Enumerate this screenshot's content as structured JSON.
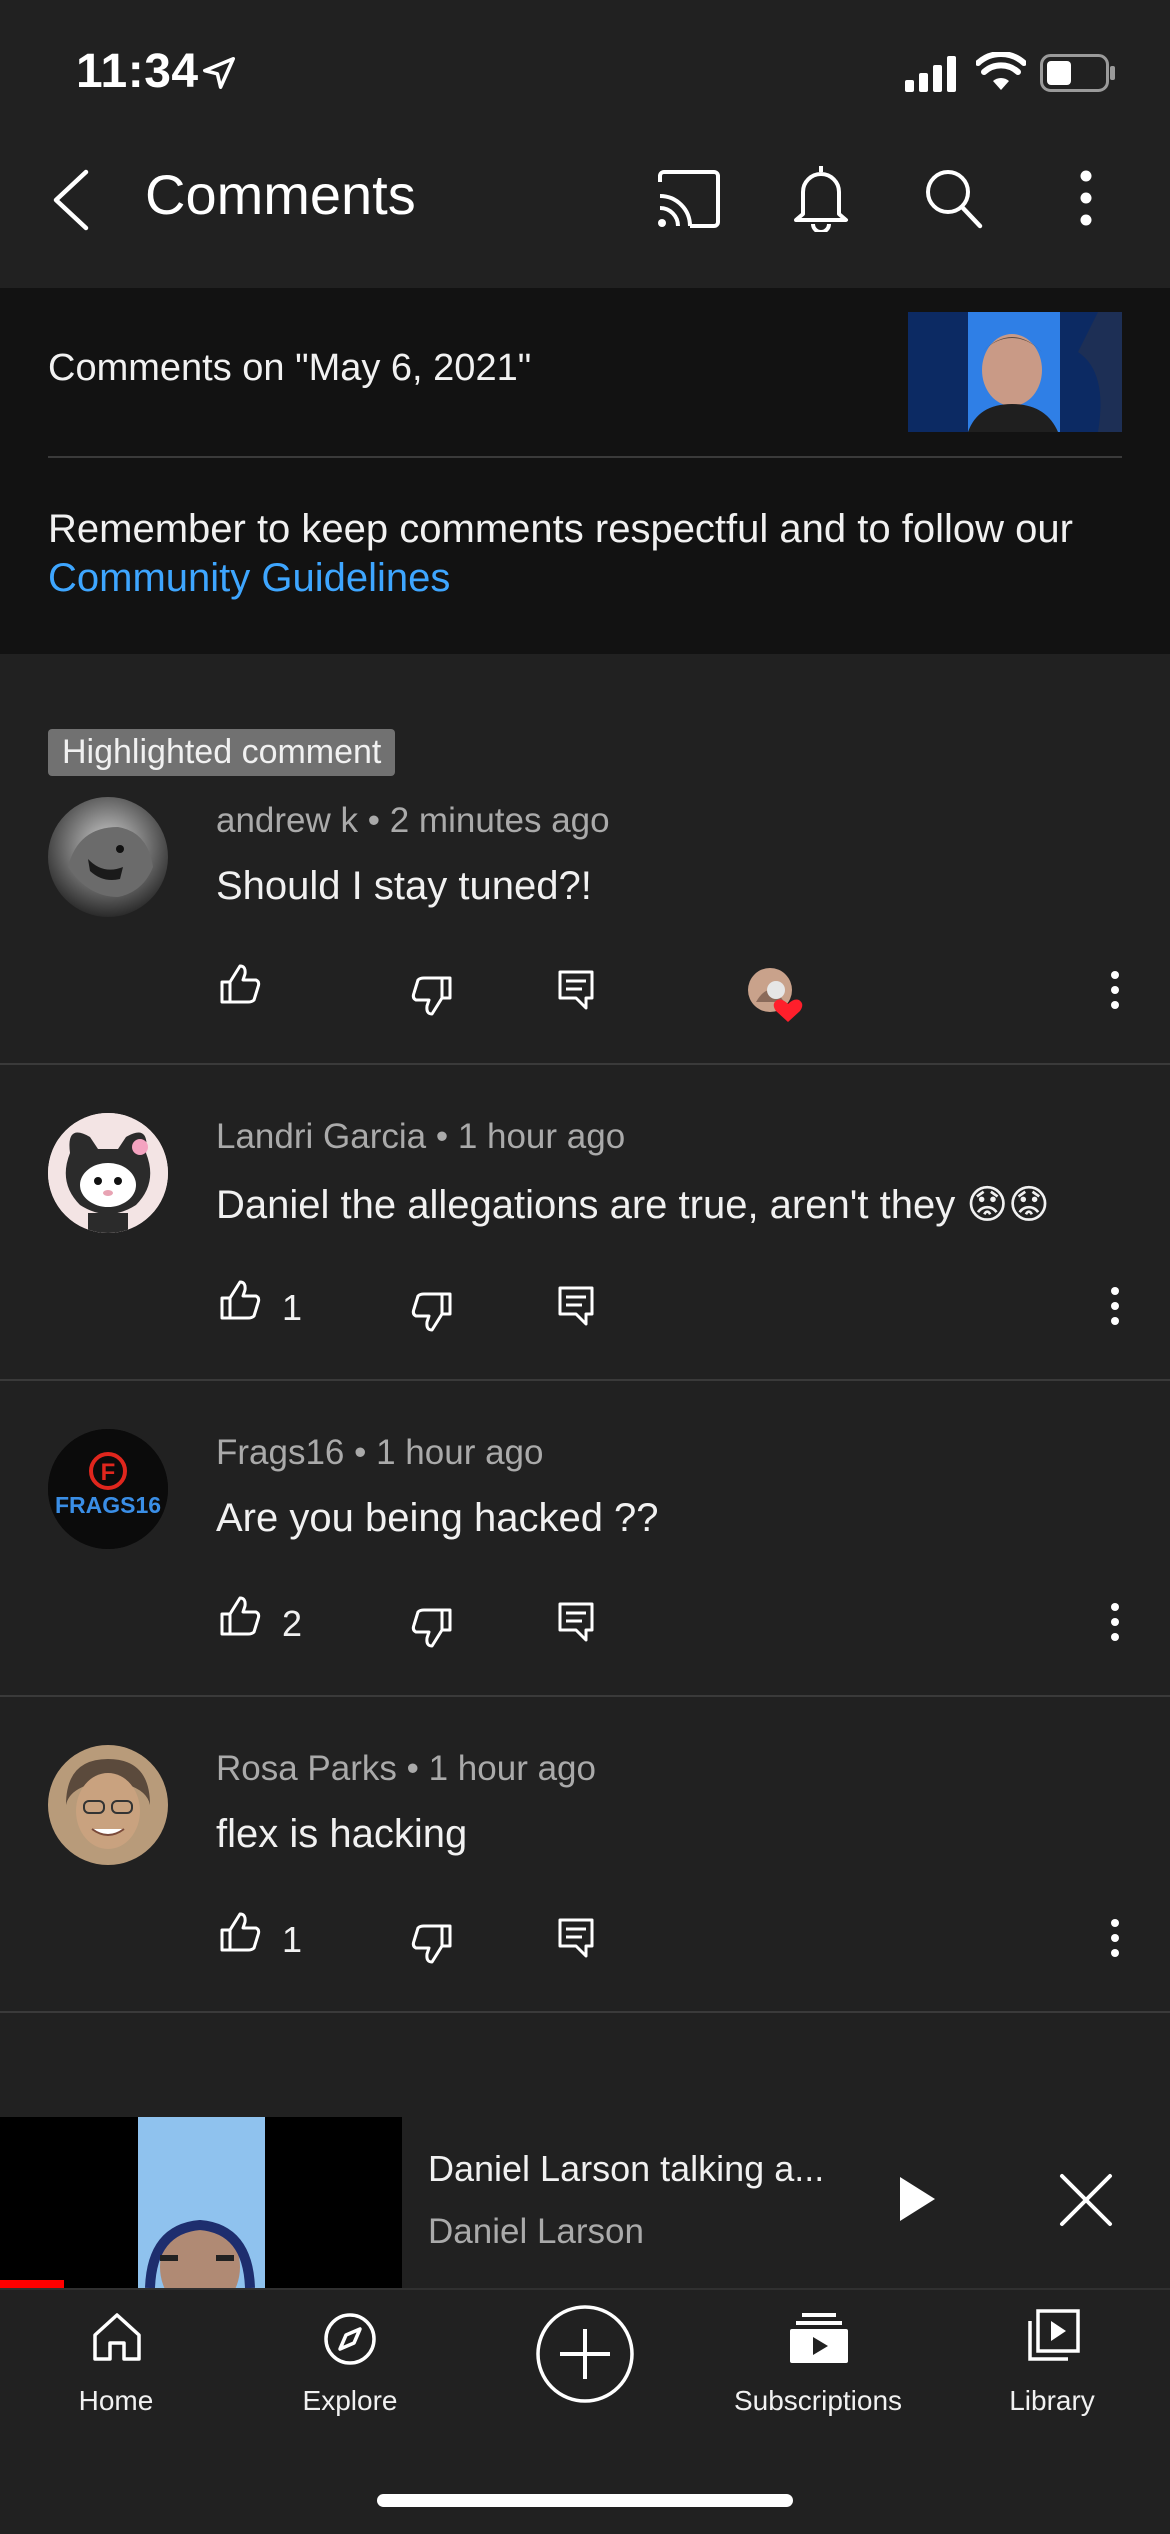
{
  "status_bar": {
    "time": "11:34"
  },
  "header": {
    "title": "Comments"
  },
  "video_info": {
    "comments_on": "Comments on \"May 6, 2021\"",
    "guidelines_text": "Remember to keep comments respectful and to follow our ",
    "guidelines_link": "Community Guidelines"
  },
  "highlight_label": "Highlighted comment",
  "comments": [
    {
      "author": "andrew k",
      "time": "2 minutes ago",
      "text": "Should I stay tuned?!",
      "likes": ""
    },
    {
      "author": "Landri Garcia",
      "time": "1 hour ago",
      "text": "Daniel the allegations are true, aren't they",
      "emoji": "😟😟",
      "likes": "1"
    },
    {
      "author": "Frags16",
      "time": "1 hour ago",
      "text": "Are you being hacked ??",
      "likes": "2"
    },
    {
      "author": "Rosa Parks",
      "time": "1 hour ago",
      "text": "flex is hacking",
      "likes": "1"
    }
  ],
  "frags_logo_text": "FRAGS16",
  "mini_player": {
    "title": "Daniel Larson talking a...",
    "channel": "Daniel Larson",
    "progress": 0.16
  },
  "bottom_nav": [
    {
      "label": "Home",
      "icon": "home-icon"
    },
    {
      "label": "Explore",
      "icon": "compass-icon"
    },
    {
      "label": "",
      "icon": "create-plus-icon"
    },
    {
      "label": "Subscriptions",
      "icon": "subscriptions-icon"
    },
    {
      "label": "Library",
      "icon": "library-icon"
    }
  ],
  "colors": {
    "background": "#212121",
    "link": "#3ea6ff",
    "info_bg": "#121212",
    "progress": "#ff0000"
  }
}
